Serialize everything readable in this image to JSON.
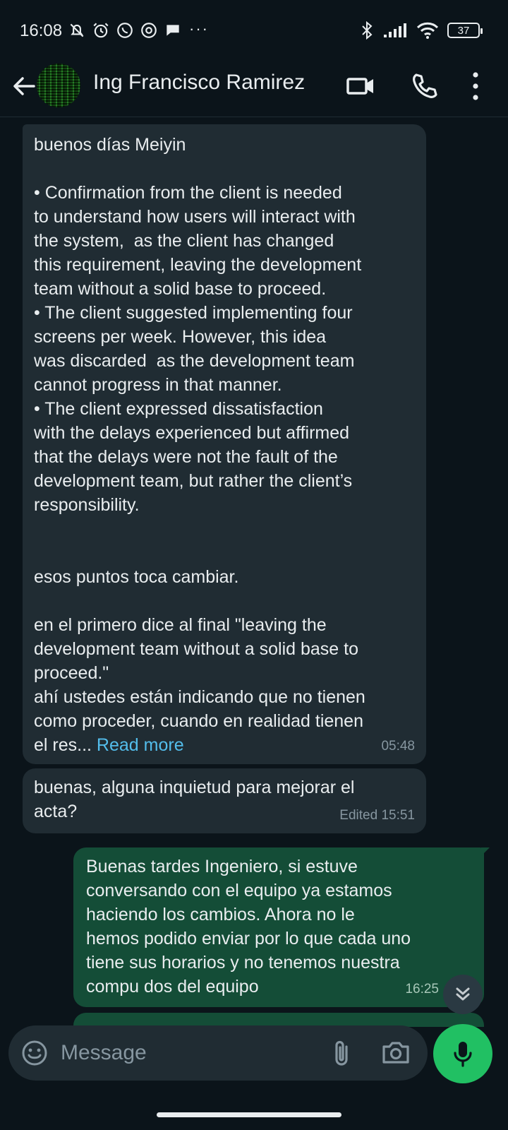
{
  "status_bar": {
    "time": "16:08",
    "battery": "37",
    "left_icons": [
      "alarm-off-icon",
      "alarm-icon",
      "whatsapp-icon",
      "at-icon",
      "chat-icon"
    ],
    "overflow": "···"
  },
  "header": {
    "contact_name": "Ing Francisco Ramirez"
  },
  "messages": [
    {
      "direction": "incoming",
      "text": "buenos días Meiyin\n\n• Confirmation from the client is needed\nto understand how users will interact with\nthe system,  as the client has changed\nthis requirement, leaving the development\nteam without a solid base to proceed.\n• The client suggested implementing four\nscreens per week. However, this idea\nwas discarded  as the development team\ncannot progress in that manner.\n• The client expressed dissatisfaction\nwith the delays experienced but affirmed\nthat the delays were not the fault of the\ndevelopment team, but rather the client’s\nresponsibility.\n\n\nesos puntos toca cambiar.\n\nen el primero dice al final \"leaving the\ndevelopment team without a solid base to\nproceed.\"\nahí ustedes están indicando que no tienen\ncomo proceder, cuando en realidad tienen\nel res... ",
      "read_more": "Read more",
      "time": "05:48"
    },
    {
      "direction": "incoming",
      "text": "buenas, alguna inquietud para mejorar el\nacta?",
      "time": "Edited 15:51"
    },
    {
      "direction": "outgoing",
      "text": "Buenas tardes Ingeniero, si estuve\nconversando con el equipo ya estamos\nhaciendo los cambios. Ahora no le\nhemos podido enviar por lo que cada uno\ntiene sus horarios y no tenemos nuestra\ncompu dos del equipo",
      "time": "16:25"
    }
  ],
  "composer": {
    "placeholder": "Message"
  },
  "colors": {
    "background": "#0b141a",
    "incoming_bubble": "#202c33",
    "outgoing_bubble": "#144d37",
    "link": "#53bdeb",
    "mic_button": "#21c063"
  }
}
